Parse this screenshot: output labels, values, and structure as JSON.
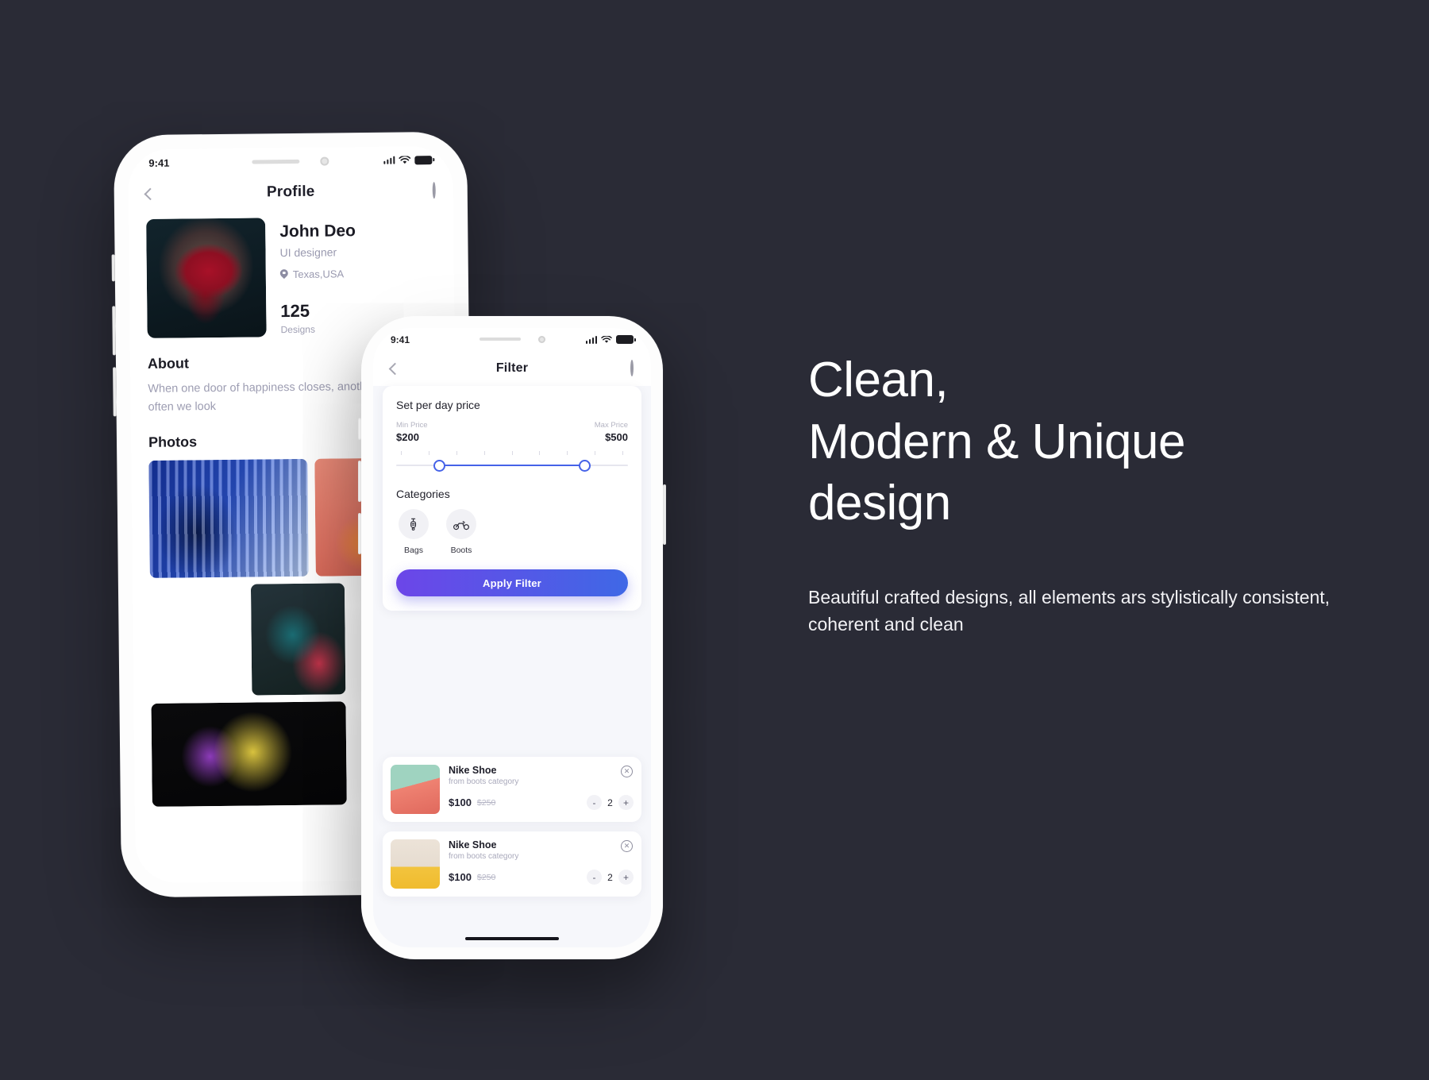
{
  "theme": {
    "background": "#2a2b36",
    "accent_purple": "#6c46e8",
    "accent_blue": "#3f68e6",
    "slider_blue": "#4562e8"
  },
  "marketing": {
    "headline_line1": "Clean,",
    "headline_line2": "Modern & Unique",
    "headline_line3": "design",
    "subtext": "Beautiful crafted designs, all elements ars stylistically consistent, coherent and clean"
  },
  "phone1": {
    "status": {
      "time": "9:41",
      "signal_icon": "signal-bars-icon",
      "wifi_icon": "wifi-icon",
      "battery_icon": "battery-icon"
    },
    "nav": {
      "back_icon": "chevron-left-icon",
      "title": "Profile",
      "search_icon": "search-icon"
    },
    "profile": {
      "avatar_name": "profile-photo",
      "name": "John Deo",
      "role": "UI designer",
      "location_icon": "location-pin-icon",
      "location": "Texas,USA",
      "stat_value": "125",
      "stat_label": "Designs"
    },
    "about": {
      "title": "About",
      "text": "When one door of happiness closes, anotheropens, but often we look"
    },
    "photos": {
      "title": "Photos",
      "items": [
        "photo-blue-stripes",
        "photo-coral",
        "photo-yellow-portrait",
        "photo-teal-red",
        "photo-night-portrait"
      ]
    }
  },
  "phone2": {
    "status": {
      "time": "9:41",
      "signal_icon": "signal-bars-icon",
      "wifi_icon": "wifi-icon",
      "battery_icon": "battery-icon"
    },
    "nav": {
      "back_icon": "chevron-left-icon",
      "title": "Filter",
      "search_icon": "search-icon"
    },
    "filter": {
      "heading": "Set per day price",
      "min_label": "Min Price",
      "min_value": "$200",
      "max_label": "Max Price",
      "max_value": "$500",
      "categories_title": "Categories",
      "categories": [
        {
          "label": "Bags",
          "icon": "scooter-icon"
        },
        {
          "label": "Boots",
          "icon": "motorcycle-icon"
        }
      ],
      "apply_label": "Apply Filter"
    },
    "products": [
      {
        "title": "Nike Shoe",
        "subtitle": "from boots category",
        "price": "$100",
        "old_price": "$250",
        "qty": "2",
        "minus": "-",
        "plus": "+",
        "close_icon": "close-circle-icon",
        "thumb": "shoe-court-photo"
      },
      {
        "title": "Nike Shoe",
        "subtitle": "from boots category",
        "price": "$100",
        "old_price": "$250",
        "qty": "2",
        "minus": "-",
        "plus": "+",
        "close_icon": "close-circle-icon",
        "thumb": "bag-model-photo"
      }
    ]
  }
}
